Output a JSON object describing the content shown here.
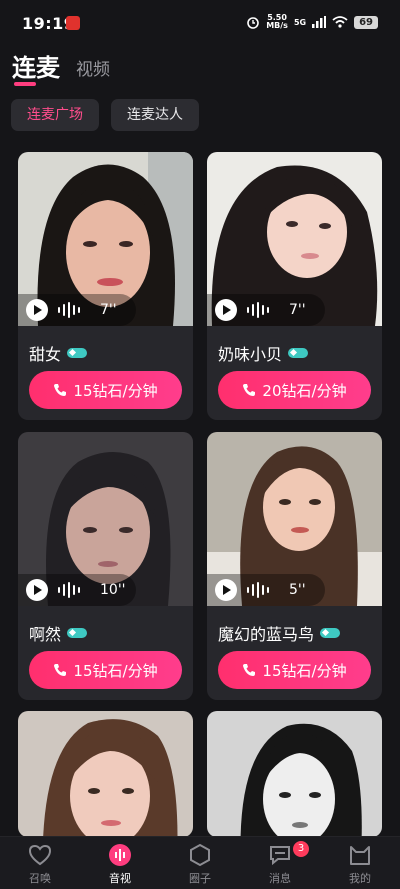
{
  "status_bar": {
    "time": "19:19",
    "network_speed_top": "5.50",
    "network_speed_unit": "MB/s",
    "network_type": "5G",
    "battery": "69"
  },
  "header": {
    "tabs": [
      {
        "label": "连麦",
        "active": true
      },
      {
        "label": "视频",
        "active": false
      }
    ]
  },
  "filters": [
    {
      "label": "连麦广场",
      "active": true
    },
    {
      "label": "连麦达人",
      "active": false
    }
  ],
  "cards": [
    {
      "name": "甜女",
      "duration": "7''",
      "price": "15钻石/分钟"
    },
    {
      "name": "奶味小贝",
      "duration": "7''",
      "price": "20钻石/分钟"
    },
    {
      "name": "啊然",
      "duration": "10''",
      "price": "15钻石/分钟"
    },
    {
      "name": "魔幻的蓝马鸟",
      "duration": "5''",
      "price": "15钻石/分钟"
    }
  ],
  "bottom_nav": {
    "items": [
      {
        "label": "召唤",
        "icon": "heart-icon"
      },
      {
        "label": "音视",
        "icon": "audio-wave-icon",
        "active": true
      },
      {
        "label": "圈子",
        "icon": "hexagon-icon"
      },
      {
        "label": "消息",
        "icon": "chat-icon",
        "badge": "3"
      },
      {
        "label": "我的",
        "icon": "cat-face-icon"
      }
    ]
  },
  "colors": {
    "accent": "#ff3d7f",
    "background": "#151518",
    "card": "#27272c",
    "badge": "#3ec9c2"
  }
}
